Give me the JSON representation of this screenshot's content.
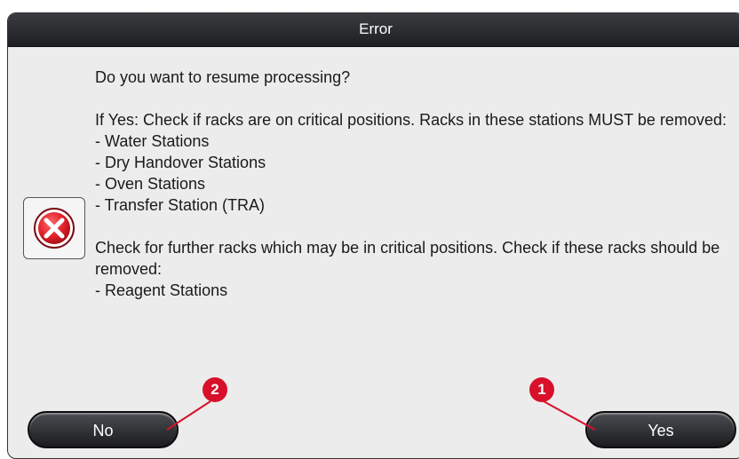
{
  "dialog": {
    "title": "Error",
    "icon": "error-x-icon",
    "question": "Do you want to resume processing?",
    "yes_intro": "If Yes: Check if racks are on critical positions. Racks in these stations MUST be removed:",
    "critical_stations": [
      "- Water Stations",
      "- Dry Handover Stations",
      "- Oven Stations",
      "- Transfer Station (TRA)"
    ],
    "further_intro": "Check for further racks which may be in critical positions. Check if these racks should be removed:",
    "further_stations": [
      "- Reagent Stations"
    ]
  },
  "buttons": {
    "no_label": "No",
    "yes_label": "Yes"
  },
  "callouts": {
    "no_button": "2",
    "yes_button": "1"
  },
  "colors": {
    "callout": "#d8102a",
    "titlebar": "#2a2b2e",
    "error_icon": "#e0202a"
  }
}
